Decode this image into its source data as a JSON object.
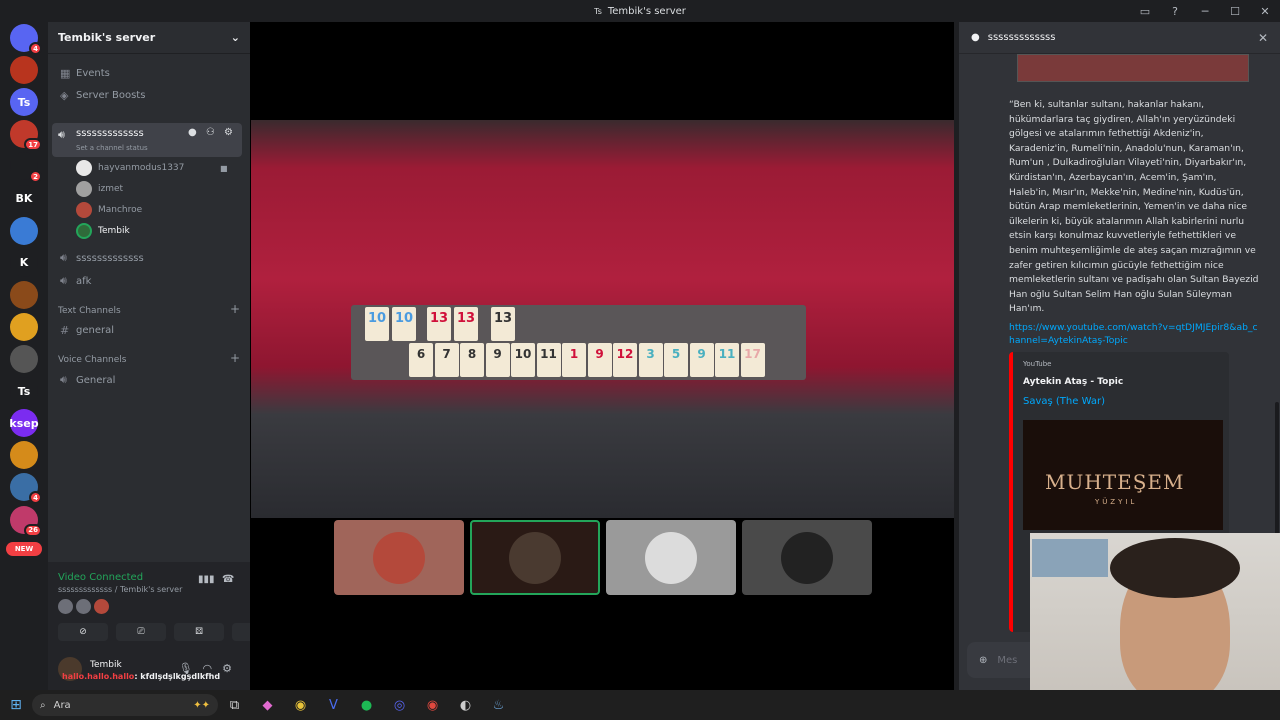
{
  "window": {
    "title": "Tembik's server",
    "title_icon": "Ts"
  },
  "guilds": [
    {
      "label": "",
      "color": "#5865f2",
      "badge": "4",
      "kind": "discord-home-icon"
    },
    {
      "label": "",
      "color": "#b8341e",
      "badge": ""
    },
    {
      "label": "Ts",
      "color": "#5865f2",
      "badge": ""
    },
    {
      "label": "",
      "color": "#c0392b",
      "badge": "17"
    },
    {
      "label": "",
      "color": "#1e1f22",
      "badge": "2"
    },
    {
      "label": "BK",
      "color": "#1e1f22",
      "badge": ""
    },
    {
      "label": "",
      "color": "#3a7bd5",
      "badge": ""
    },
    {
      "label": "K",
      "color": "#1e1f22",
      "badge": ""
    },
    {
      "label": "",
      "color": "#8a4a1a",
      "badge": ""
    },
    {
      "label": "",
      "color": "#e0a020",
      "badge": ""
    },
    {
      "label": "",
      "color": "#555",
      "badge": ""
    },
    {
      "label": "Ts",
      "color": "#1e1f22",
      "badge": ""
    },
    {
      "label": "ksep",
      "color": "#7b2cf0",
      "badge": ""
    },
    {
      "label": "",
      "color": "#d58b1a",
      "badge": ""
    },
    {
      "label": "",
      "color": "#3a6ea5",
      "badge": "4"
    },
    {
      "label": "",
      "color": "#c03a6a",
      "badge": "26"
    }
  ],
  "new_badge": "NEW",
  "server": {
    "name": "Tembik's server",
    "menu_items": [
      "Events",
      "Server Boosts"
    ],
    "active_channel": {
      "name": "sssssssssssss",
      "status": "Set a channel status"
    },
    "voice_users": [
      "hayvanmodus1337",
      "izmet",
      "Manchroe",
      "Tembik"
    ],
    "voice_channels": [
      "sssssssssssss",
      "afk"
    ],
    "text_category": "Text Channels",
    "text_channels": [
      "general"
    ],
    "voice_category": "Voice Channels",
    "voice_channels_2": [
      "General"
    ]
  },
  "voice_panel": {
    "title": "Video Connected",
    "subtitle": "sssssssssssss / Tembik's server",
    "user": "Tembik",
    "status_prefix": "hallo.hallo.hallo",
    "status_text": ": kfdlşdşlkgşdlkfhd"
  },
  "thread": {
    "title": "sssssssssssss",
    "message": "“Ben ki, sultanlar sultanı, hakanlar hakanı, hükümdarlara taç giydiren, Allah'ın yeryüzündeki gölgesi ve atalarımın fethettiği Akdeniz'in, Karadeniz'in, Rumeli'nin, Anadolu'nun, Karaman'ın, Rum'un , Dulkadiroğluları Vilayeti'nin, Diyarbakır'ın, Kürdistan'ın, Azerbaycan'ın, Acem'in, Şam'ın, Haleb'in, Mısır'ın, Mekke'nin, Medine'nin, Kudüs'ün, bütün Arap memleketlerinin, Yemen'in ve daha nice ülkelerin ki, büyük atalarımın Allah kabirlerini nurlu etsin karşı konulmaz kuvvetleriyle fethettikleri ve benim muhteşemliğimle de ateş saçan mızrağımın ve zafer getiren kılıcımın gücüyle fethettiğim nice memleketlerin sultanı ve padişahı olan Sultan Bayezid Han oğlu Sultan Selim Han oğlu Sulan Süleyman Han'ım.",
    "link": "https://www.youtube.com/watch?v=qtDJMJEpir8&ab_channel=AytekinAtaş-Topic",
    "embed_provider": "YouTube",
    "embed_author": "Aytekin Ataş - Topic",
    "embed_title": "Savaş (The War)",
    "embed_video_title": "MUHTEŞEM",
    "embed_video_sub": "YÜZYIL",
    "input_placeholder": "Mes"
  },
  "taskbar": {
    "search_placeholder": "Ara"
  }
}
